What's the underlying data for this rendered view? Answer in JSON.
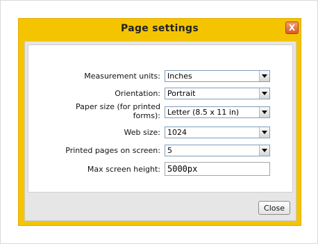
{
  "dialog": {
    "title": "Page settings",
    "close_icon_glyph": "X",
    "close_button_label": "Close",
    "accent_color": "#f5c400"
  },
  "form": {
    "measurement_units": {
      "label": "Measurement units:",
      "value": "Inches"
    },
    "orientation": {
      "label": "Orientation:",
      "value": "Portrait"
    },
    "paper_size": {
      "label": "Paper size (for printed forms):",
      "value": "Letter (8.5 x 11 in)"
    },
    "web_size": {
      "label": "Web size:",
      "value": "1024"
    },
    "printed_pages": {
      "label": "Printed pages on screen:",
      "value": "5"
    },
    "max_screen_height": {
      "label": "Max screen height:",
      "value": "5000px"
    }
  },
  "icons": {
    "close": "close-icon",
    "dropdown": "chevron-down-icon"
  }
}
